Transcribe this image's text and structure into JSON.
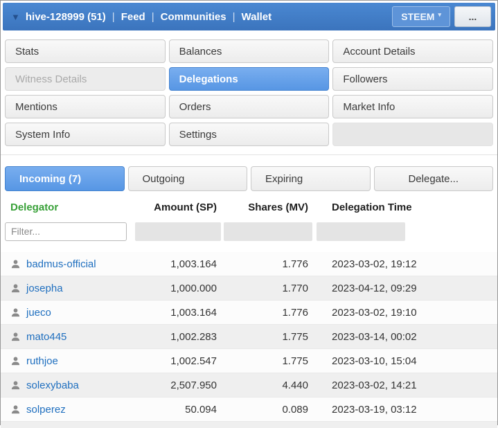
{
  "topbar": {
    "account": "hive-128999 (51)",
    "nav": [
      "Feed",
      "Communities",
      "Wallet"
    ],
    "separator": "|",
    "steem_button": "STEEM",
    "more_button": "..."
  },
  "nav_buttons": [
    {
      "label": "Stats",
      "state": "normal"
    },
    {
      "label": "Balances",
      "state": "normal"
    },
    {
      "label": "Account Details",
      "state": "normal"
    },
    {
      "label": "Witness Details",
      "state": "disabled"
    },
    {
      "label": "Delegations",
      "state": "active"
    },
    {
      "label": "Followers",
      "state": "normal"
    },
    {
      "label": "Mentions",
      "state": "normal"
    },
    {
      "label": "Orders",
      "state": "normal"
    },
    {
      "label": "Market Info",
      "state": "normal"
    },
    {
      "label": "System Info",
      "state": "normal"
    },
    {
      "label": "Settings",
      "state": "normal"
    },
    {
      "label": "",
      "state": "empty"
    }
  ],
  "tabs": [
    {
      "label": "Incoming (7)",
      "active": true
    },
    {
      "label": "Outgoing",
      "active": false
    },
    {
      "label": "Expiring",
      "active": false
    },
    {
      "label": "Delegate...",
      "active": false
    }
  ],
  "table": {
    "headers": [
      "Delegator",
      "Amount (SP)",
      "Shares (MV)",
      "Delegation Time"
    ],
    "filter_placeholder": "Filter...",
    "rows": [
      {
        "delegator": "badmus-official",
        "amount": "1,003.164",
        "shares": "1.776",
        "time": "2023-03-02, 19:12"
      },
      {
        "delegator": "josepha",
        "amount": "1,000.000",
        "shares": "1.770",
        "time": "2023-04-12, 09:29"
      },
      {
        "delegator": "jueco",
        "amount": "1,003.164",
        "shares": "1.776",
        "time": "2023-03-02, 19:10"
      },
      {
        "delegator": "mato445",
        "amount": "1,002.283",
        "shares": "1.775",
        "time": "2023-03-14, 00:02"
      },
      {
        "delegator": "ruthjoe",
        "amount": "1,002.547",
        "shares": "1.775",
        "time": "2023-03-10, 15:04"
      },
      {
        "delegator": "solexybaba",
        "amount": "2,507.950",
        "shares": "4.440",
        "time": "2023-03-02, 14:21"
      },
      {
        "delegator": "solperez",
        "amount": "50.094",
        "shares": "0.089",
        "time": "2023-03-19, 03:12"
      }
    ]
  },
  "colors": {
    "topbar_bg": "#3f7cc6",
    "active_button": "#5796e4",
    "link": "#1f6fbf",
    "delegator_header_green": "#37a037"
  }
}
